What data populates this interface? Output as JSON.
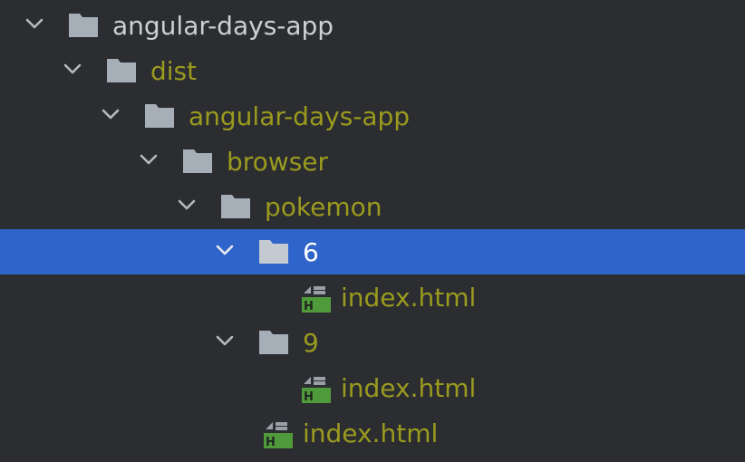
{
  "tree": {
    "root": {
      "label": "angular-days-app"
    },
    "dist": {
      "label": "dist"
    },
    "app": {
      "label": "angular-days-app"
    },
    "browser": {
      "label": "browser"
    },
    "pokemon": {
      "label": "pokemon"
    },
    "folder6": {
      "label": "6",
      "file": "index.html"
    },
    "folder9": {
      "label": "9",
      "file": "index.html"
    },
    "pokemon_file": {
      "label": "index.html"
    }
  },
  "icons": {
    "chevron": "chevron-down-icon",
    "folder": "folder-icon",
    "html_file": "html-file-icon"
  },
  "colors": {
    "background": "#2b2d30",
    "selection": "#2f65ca",
    "root_text": "#cdd0d4",
    "excluded_text": "#9a9a1f",
    "selected_text": "#ffffff",
    "folder_icon": "#a6aeb8",
    "html_badge": "#4f9a3a"
  }
}
